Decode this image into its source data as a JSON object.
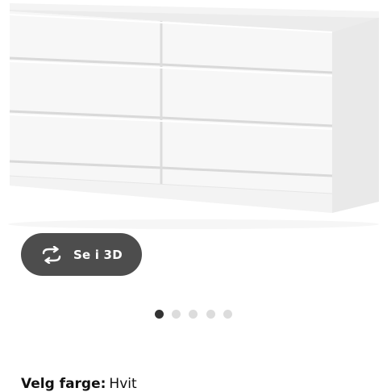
{
  "product": {
    "image_alt": "dresser-6-drawers",
    "view_3d_label": "Se i 3D",
    "view_3d_icon": "rotate-3d-icon"
  },
  "carousel": {
    "count": 5,
    "active_index": 0
  },
  "color": {
    "label": "Velg farge:",
    "value": "Hvit"
  },
  "colors": {
    "button_bg": "#4d4d4d",
    "dot_active": "#333333",
    "dot_inactive": "#dcdcdc"
  }
}
